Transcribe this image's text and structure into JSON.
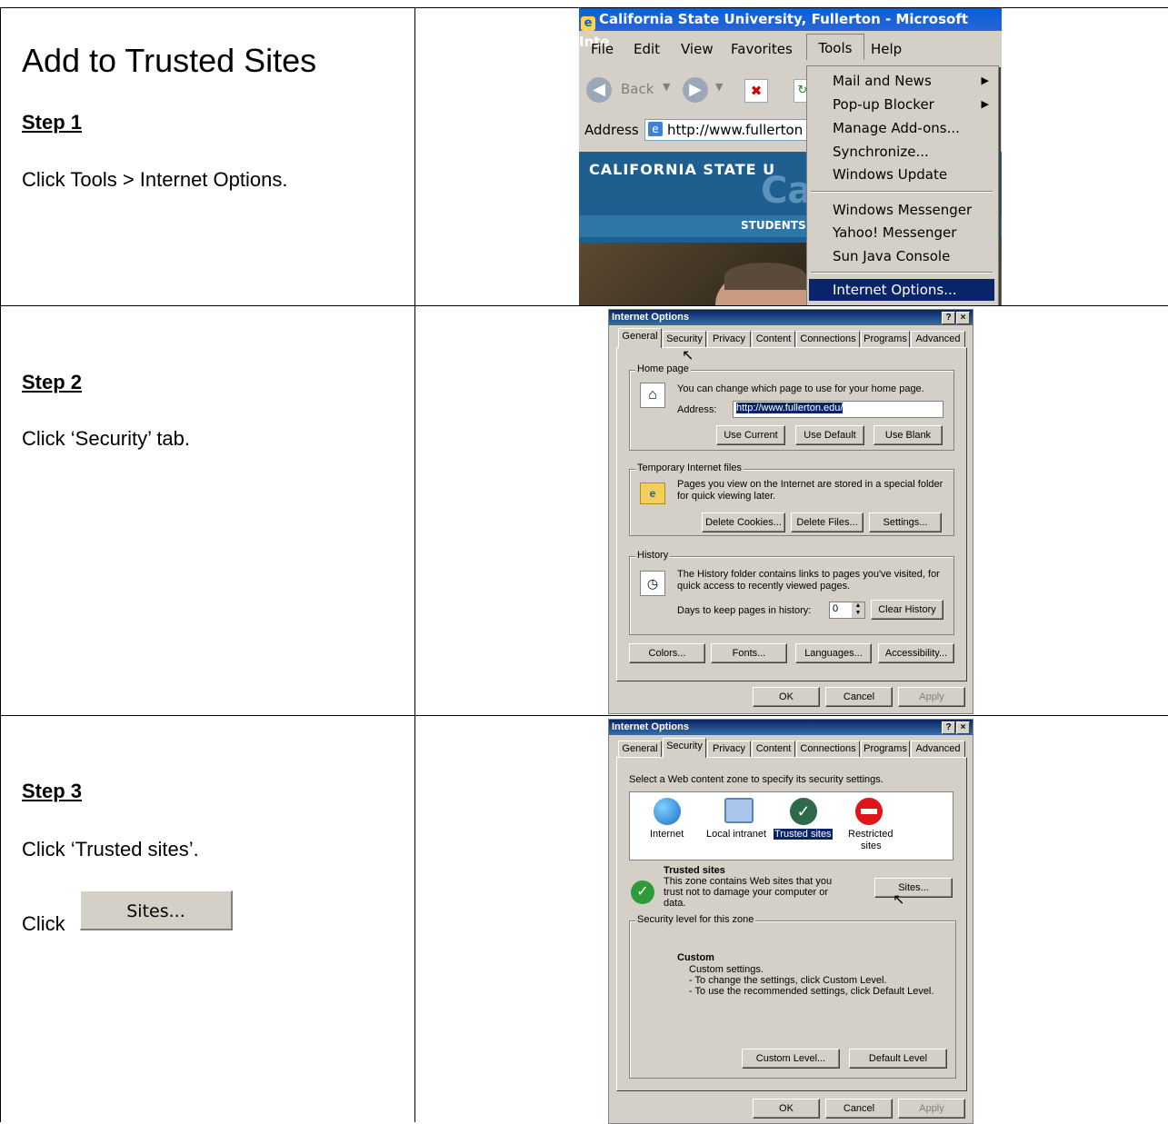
{
  "page": {
    "title": "Add to Trusted Sites",
    "step1": {
      "heading": "Step 1",
      "text": "Click Tools > Internet Options."
    },
    "step2": {
      "heading": "Step 2",
      "text": "Click ‘Security’ tab."
    },
    "step3": {
      "heading": "Step 3",
      "text": "Click ‘Trusted sites’.",
      "click_prefix": "Click",
      "sites_button": "Sites..."
    }
  },
  "ie": {
    "window_title": "California State University, Fullerton - Microsoft Inte",
    "menu": [
      "File",
      "Edit",
      "View",
      "Favorites",
      "Tools",
      "Help"
    ],
    "back_label": "Back",
    "address_label": "Address",
    "address_value": "http://www.fullerton",
    "banner_text": "CALIFORNIA STATE U",
    "banner_students": "STUDENTS",
    "tools_menu": [
      "Mail and News",
      "Pop-up Blocker",
      "Manage Add-ons...",
      "Synchronize...",
      "Windows Update",
      "Windows Messenger",
      "Yahoo! Messenger",
      "Sun Java Console",
      "Internet Options..."
    ]
  },
  "dialog1": {
    "title": "Internet Options",
    "tabs": [
      "General",
      "Security",
      "Privacy",
      "Content",
      "Connections",
      "Programs",
      "Advanced"
    ],
    "home_group": "Home page",
    "home_text": "You can change which page to use for your home page.",
    "address_label": "Address:",
    "address_value": "http://www.fullerton.edu/",
    "use_current": "Use Current",
    "use_default": "Use Default",
    "use_blank": "Use Blank",
    "temp_group": "Temporary Internet files",
    "temp_text1": "Pages you view on the Internet are stored in a special folder",
    "temp_text2": "for quick viewing later.",
    "delete_cookies": "Delete Cookies...",
    "delete_files": "Delete Files...",
    "settings": "Settings...",
    "history_group": "History",
    "history_text1": "The History folder contains links to pages you've visited, for",
    "history_text2": "quick access to recently viewed pages.",
    "days_label": "Days to keep pages in history:",
    "days_value": "0",
    "clear_history": "Clear History",
    "colors": "Colors...",
    "fonts": "Fonts...",
    "languages": "Languages...",
    "accessibility": "Accessibility...",
    "ok": "OK",
    "cancel": "Cancel",
    "apply": "Apply"
  },
  "dialog2": {
    "title": "Internet Options",
    "tabs": [
      "General",
      "Security",
      "Privacy",
      "Content",
      "Connections",
      "Programs",
      "Advanced"
    ],
    "zone_prompt": "Select a Web content zone to specify its security settings.",
    "zones": [
      "Internet",
      "Local intranet",
      "Trusted sites",
      "Restricted",
      "sites"
    ],
    "zone_title": "Trusted sites",
    "zone_desc1": "This zone contains Web sites that you",
    "zone_desc2": "trust not to damage your computer or",
    "zone_desc3": "data.",
    "sites": "Sites...",
    "level_group": "Security level for this zone",
    "level_title": "Custom",
    "level_line1": "Custom settings.",
    "level_line2": "- To change the settings, click Custom Level.",
    "level_line3": "- To use the recommended settings, click Default Level.",
    "custom_level": "Custom Level...",
    "default_level": "Default Level",
    "ok": "OK",
    "cancel": "Cancel",
    "apply": "Apply"
  }
}
